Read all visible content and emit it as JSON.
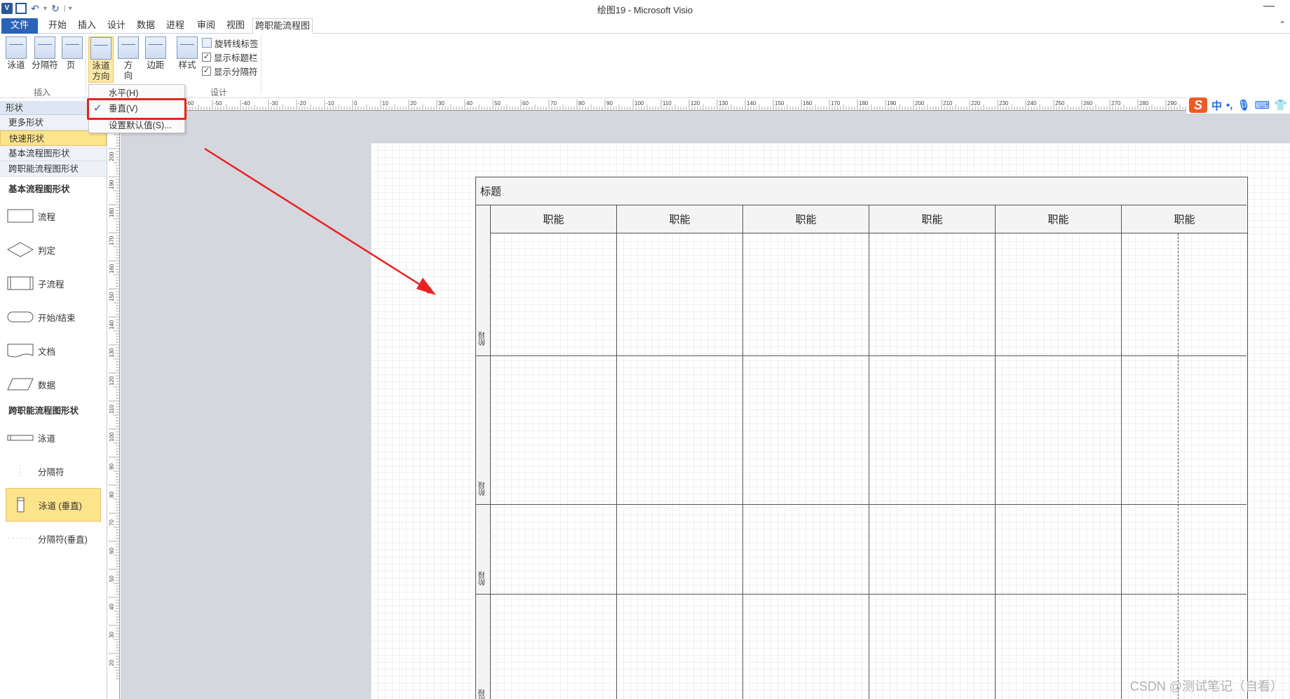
{
  "window": {
    "title": "绘图19 - Microsoft Visio"
  },
  "ribbon": {
    "tabs": [
      "文件",
      "开始",
      "插入",
      "设计",
      "数据",
      "进程",
      "审阅",
      "视图",
      "跨职能流程图"
    ],
    "active_tab": "跨职能流程图",
    "buttons": {
      "swimlane": "泳道",
      "separator": "分隔符",
      "page": "页",
      "lane_direction_1": "泳道",
      "lane_direction_2": "方向",
      "direction_1": "方",
      "direction_2": "向",
      "margins": "边距",
      "style": "样式"
    },
    "checkboxes": [
      {
        "label": "旋转线标签",
        "checked": false
      },
      {
        "label": "显示标题栏",
        "checked": true
      },
      {
        "label": "显示分隔符",
        "checked": true
      }
    ],
    "groups": {
      "insert": "插入",
      "design": "设计"
    }
  },
  "dropdown": {
    "items": [
      {
        "label": "水平(H)",
        "checked": false
      },
      {
        "label": "垂直(V)",
        "checked": true
      },
      {
        "label": "设置默认值(S)...",
        "checked": false
      }
    ]
  },
  "shapes_pane": {
    "header": "形状",
    "nav": [
      "更多形状",
      "快速形状",
      "基本流程图形状",
      "跨职能流程图形状"
    ],
    "active_nav": "快速形状",
    "stencils": [
      {
        "title": "基本流程图形状",
        "items": [
          "流程",
          "判定",
          "子流程",
          "开始/结束",
          "文档",
          "数据"
        ]
      },
      {
        "title": "跨职能流程图形状",
        "items": [
          "泳道",
          "分隔符",
          "泳道 (垂直)",
          "分隔符(垂直)"
        ]
      }
    ],
    "active_item": "泳道 (垂直)"
  },
  "ruler": {
    "h_labels": [
      "-60",
      "-50",
      "-40",
      "-30",
      "-20",
      "-10",
      "0",
      "10",
      "20",
      "30",
      "40",
      "50",
      "60",
      "70",
      "80",
      "90",
      "100",
      "110",
      "120",
      "130",
      "140",
      "150",
      "160",
      "170",
      "180",
      "190",
      "200",
      "210",
      "220",
      "230",
      "240",
      "250",
      "260",
      "270",
      "280",
      "290"
    ],
    "v_labels": [
      "210",
      "200",
      "190",
      "180",
      "170",
      "160",
      "150",
      "140",
      "130",
      "120",
      "110",
      "100",
      "90",
      "80",
      "70",
      "60",
      "50",
      "40",
      "30",
      "20"
    ]
  },
  "ime": {
    "lang": "中",
    "punct": "•,",
    "mic": "mic-icon",
    "keyboard": "keyboard-icon",
    "shirt": "skin-icon"
  },
  "diagram": {
    "title": "标题",
    "functions": [
      "职能",
      "职能",
      "职能",
      "职能",
      "职能",
      "职能"
    ],
    "phases": [
      "阶段",
      "阶段",
      "阶段",
      "阶段"
    ]
  },
  "watermark": "CSDN @测试笔记（自看）",
  "colors": {
    "accent": "#2a63b8",
    "highlight": "#fde38a",
    "annotation": "#e82222"
  }
}
